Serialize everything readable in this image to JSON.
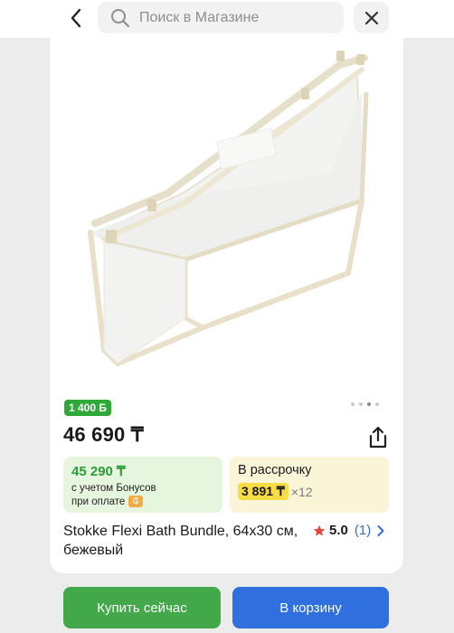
{
  "header": {
    "search_placeholder": "Поиск в Магазине",
    "icons": [
      "chevron-left-icon",
      "search-icon",
      "close-icon"
    ]
  },
  "product": {
    "bonus_badge": "1 400 Б",
    "price": "46 690 ₸",
    "gallery": {
      "total_images": 4,
      "active_index": 2
    },
    "bonus_offer": {
      "price": "45 290 ₸",
      "note_line1": "с учетом Бонусов",
      "note_line2": "при оплате"
    },
    "installment": {
      "title": "В рассрочку",
      "monthly": "3 891 ₸",
      "months": "×12"
    },
    "title": "Stokke Flexi Bath Bundle, 64x30 см, бежевый",
    "rating": {
      "score": "5.0",
      "count": "(1)"
    }
  },
  "actions": {
    "buy_now": "Купить сейчас",
    "add_to_cart": "В корзину"
  },
  "colors": {
    "green": "#42a84a",
    "blue": "#2f6fde",
    "bonus_bg": "#e6f5dd",
    "installment_bg": "#fbf5d8",
    "installment_pill": "#f7dc45"
  }
}
